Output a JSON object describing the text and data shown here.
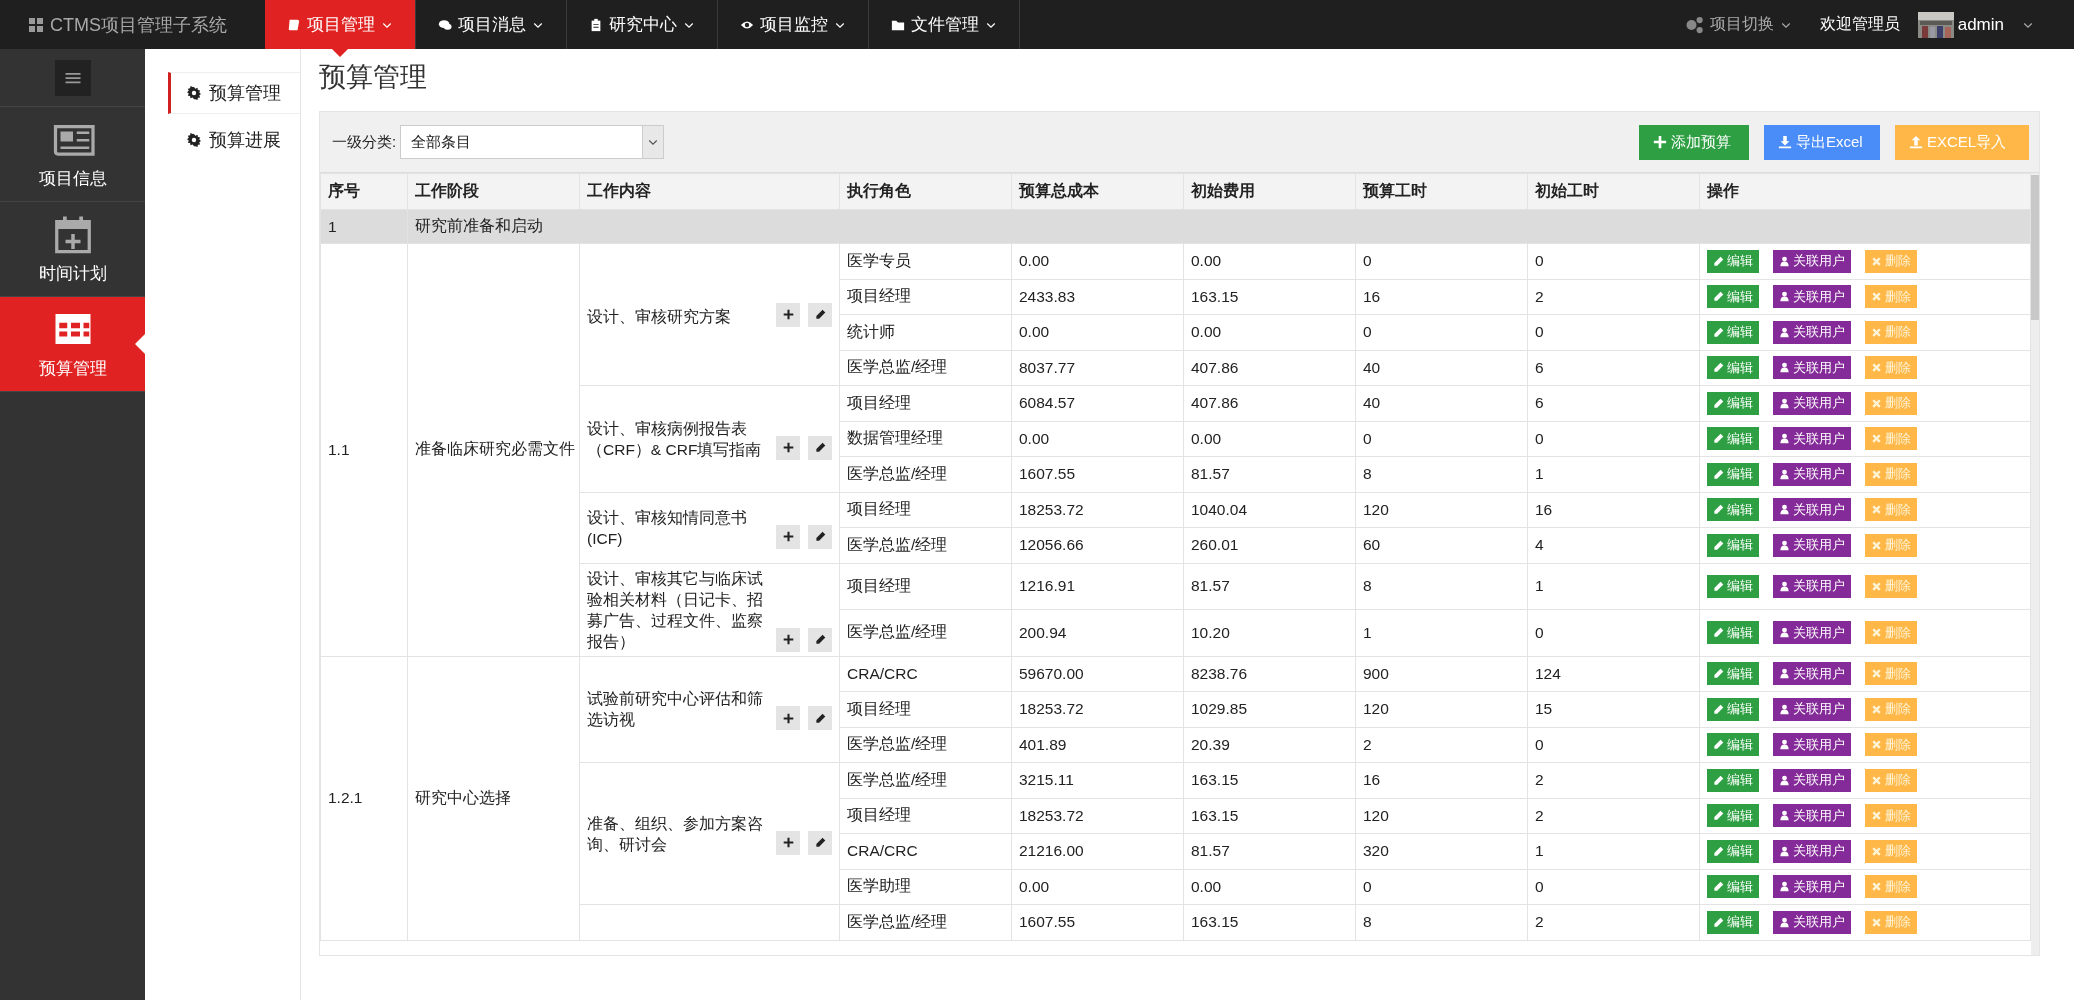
{
  "top_bar": {
    "brand": "CTMS项目管理子系统",
    "menu": [
      {
        "label": "项目管理",
        "selected": true
      },
      {
        "label": "项目消息",
        "selected": false
      },
      {
        "label": "研究中心",
        "selected": false
      },
      {
        "label": "项目监控",
        "selected": false
      },
      {
        "label": "文件管理",
        "selected": false
      }
    ],
    "project_switch": "项目切换",
    "welcome": "欢迎管理员",
    "user": "admin"
  },
  "sidebar": {
    "items": [
      {
        "label": "项目信息",
        "selected": false
      },
      {
        "label": "时间计划",
        "selected": false
      },
      {
        "label": "预算管理",
        "selected": true
      }
    ]
  },
  "subnav": {
    "items": [
      {
        "label": "预算管理",
        "selected": true
      },
      {
        "label": "预算进展",
        "selected": false
      }
    ]
  },
  "page_title": "预算管理",
  "filter": {
    "label": "一级分类:",
    "value": "全部条目"
  },
  "toolbar": [
    {
      "kind": "add",
      "label": "添加预算"
    },
    {
      "kind": "export",
      "label": "导出Excel"
    },
    {
      "kind": "import",
      "label": "EXCEL导入"
    }
  ],
  "table": {
    "columns": [
      "序号",
      "工作阶段",
      "工作内容",
      "执行角色",
      "预算总成本",
      "初始费用",
      "预算工时",
      "初始工时",
      "操作"
    ],
    "groups": [
      {
        "seq": "1",
        "stage": "研究前准备和启动",
        "sections": [
          {
            "seq": "1.1",
            "stage": "准备临床研究必需文件",
            "tasks": [
              {
                "content": "设计、审核研究方案",
                "roles": [
                  {
                    "cells": [
                      "医学专员",
                      "0.00",
                      "0.00",
                      "0",
                      "0"
                    ],
                    "actions": [
                      "编辑",
                      "关联用户",
                      "删除"
                    ]
                  },
                  {
                    "cells": [
                      "项目经理",
                      "2433.83",
                      "163.15",
                      "16",
                      "2"
                    ],
                    "actions": [
                      "编辑",
                      "关联用户",
                      "删除"
                    ]
                  },
                  {
                    "cells": [
                      "统计师",
                      "0.00",
                      "0.00",
                      "0",
                      "0"
                    ],
                    "actions": [
                      "编辑",
                      "关联用户",
                      "删除"
                    ]
                  },
                  {
                    "cells": [
                      "医学总监/经理",
                      "8037.77",
                      "407.86",
                      "40",
                      "6"
                    ],
                    "actions": [
                      "编辑",
                      "关联用户",
                      "删除"
                    ]
                  }
                ]
              },
              {
                "content": "设计、审核病例报告表（CRF）& CRF填写指南",
                "roles": [
                  {
                    "cells": [
                      "项目经理",
                      "6084.57",
                      "407.86",
                      "40",
                      "6"
                    ],
                    "actions": [
                      "编辑",
                      "关联用户",
                      "删除"
                    ]
                  },
                  {
                    "cells": [
                      "数据管理经理",
                      "0.00",
                      "0.00",
                      "0",
                      "0"
                    ],
                    "actions": [
                      "编辑",
                      "关联用户",
                      "删除"
                    ]
                  },
                  {
                    "cells": [
                      "医学总监/经理",
                      "1607.55",
                      "81.57",
                      "8",
                      "1"
                    ],
                    "actions": [
                      "编辑",
                      "关联用户",
                      "删除"
                    ]
                  }
                ]
              },
              {
                "content": "设计、审核知情同意书(ICF)",
                "roles": [
                  {
                    "cells": [
                      "项目经理",
                      "18253.72",
                      "1040.04",
                      "120",
                      "16"
                    ],
                    "actions": [
                      "编辑",
                      "关联用户",
                      "删除"
                    ]
                  },
                  {
                    "cells": [
                      "医学总监/经理",
                      "12056.66",
                      "260.01",
                      "60",
                      "4"
                    ],
                    "actions": [
                      "编辑",
                      "关联用户",
                      "删除"
                    ]
                  }
                ]
              },
              {
                "content": "设计、审核其它与临床试验相关材料（日记卡、招募广告、过程文件、监察报告）",
                "roles": [
                  {
                    "cells": [
                      "项目经理",
                      "1216.91",
                      "81.57",
                      "8",
                      "1"
                    ],
                    "actions": [
                      "编辑",
                      "关联用户",
                      "删除"
                    ]
                  },
                  {
                    "cells": [
                      "医学总监/经理",
                      "200.94",
                      "10.20",
                      "1",
                      "0"
                    ],
                    "actions": [
                      "编辑",
                      "关联用户",
                      "删除"
                    ]
                  }
                ]
              }
            ]
          },
          {
            "seq": "1.2.1",
            "stage": "研究中心选择",
            "tasks": [
              {
                "content": "试验前研究中心评估和筛选访视",
                "roles": [
                  {
                    "cells": [
                      "CRA/CRC",
                      "59670.00",
                      "8238.76",
                      "900",
                      "124"
                    ],
                    "actions": [
                      "编辑",
                      "关联用户",
                      "删除"
                    ]
                  },
                  {
                    "cells": [
                      "项目经理",
                      "18253.72",
                      "1029.85",
                      "120",
                      "15"
                    ],
                    "actions": [
                      "编辑",
                      "关联用户",
                      "删除"
                    ]
                  },
                  {
                    "cells": [
                      "医学总监/经理",
                      "401.89",
                      "20.39",
                      "2",
                      "0"
                    ],
                    "actions": [
                      "编辑",
                      "关联用户",
                      "删除"
                    ]
                  }
                ]
              },
              {
                "content": "准备、组织、参加方案咨询、研讨会",
                "roles": [
                  {
                    "cells": [
                      "医学总监/经理",
                      "3215.11",
                      "163.15",
                      "16",
                      "2"
                    ],
                    "actions": [
                      "编辑",
                      "关联用户",
                      "删除"
                    ]
                  },
                  {
                    "cells": [
                      "项目经理",
                      "18253.72",
                      "163.15",
                      "120",
                      "2"
                    ],
                    "actions": [
                      "编辑",
                      "关联用户",
                      "删除"
                    ]
                  },
                  {
                    "cells": [
                      "CRA/CRC",
                      "21216.00",
                      "81.57",
                      "320",
                      "1"
                    ],
                    "actions": [
                      "编辑",
                      "关联用户",
                      "删除"
                    ]
                  },
                  {
                    "cells": [
                      "医学助理",
                      "0.00",
                      "0.00",
                      "0",
                      "0"
                    ],
                    "actions": [
                      "编辑",
                      "关联用户",
                      "删除"
                    ]
                  }
                ]
              },
              {
                "roles": [
                  {
                    "cells": [
                      "医学总监/经理",
                      "1607.55",
                      "163.15",
                      "8",
                      "2"
                    ],
                    "actions": [
                      "编辑",
                      "关联用户",
                      "删除"
                    ]
                  }
                ]
              }
            ]
          }
        ]
      }
    ]
  }
}
